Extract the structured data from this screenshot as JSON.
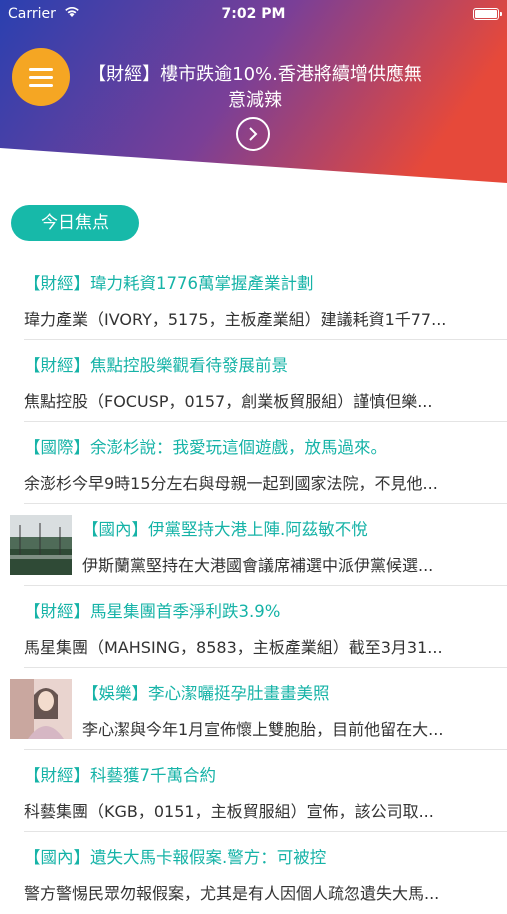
{
  "status_bar": {
    "carrier": "Carrier",
    "time": "7:02 PM"
  },
  "header": {
    "headline": "【財經】樓市跌逾10%.香港將續增供應無意減辣",
    "gradient_colors": [
      "#2b3fae",
      "#8a3f8c",
      "#e34a3a"
    ],
    "menu_color": "#f5a623"
  },
  "section": {
    "label": "今日焦点",
    "accent": "#17b9a9"
  },
  "news": [
    {
      "title": "【財經】瑋力耗資1776萬掌握產業計劃",
      "summary": "瑋力產業（IVORY，5175，主板產業組）建議耗資1千77...",
      "thumb": ""
    },
    {
      "title": "【財經】焦點控股樂觀看待發展前景",
      "summary": "焦點控股（FOCUSP，0157，創業板貿服組）謹慎但樂...",
      "thumb": ""
    },
    {
      "title": "【國際】余澎杉說：我愛玩這個遊戲，放馬過來。",
      "summary": "余澎杉今早9時15分左右與母親一起到國家法院，不見他...",
      "thumb": ""
    },
    {
      "title": "【國內】伊黨堅持大港上陣.阿茲敏不悅",
      "summary": "伊斯蘭黨堅持在大港國會議席補選中派伊黨候選...",
      "thumb": "field-photo"
    },
    {
      "title": "【財經】馬星集團首季淨利跌3.9%",
      "summary": "馬星集團（MAHSING，8583，主板產業組）截至3月31...",
      "thumb": ""
    },
    {
      "title": "【娛樂】李心潔曬挺孕肚畫畫美照",
      "summary": "李心潔與今年1月宣佈懷上雙胞胎，目前他留在大...",
      "thumb": "portrait-photo"
    },
    {
      "title": "【財經】科藝獲7千萬合約",
      "summary": "科藝集團（KGB，0151，主板貿服組）宣佈，該公司取...",
      "thumb": ""
    },
    {
      "title": "【國內】遺失大馬卡報假案.警方：可被控",
      "summary": "警方警惕民眾勿報假案，尤其是有人因個人疏忽遺失大馬...",
      "thumb": ""
    }
  ]
}
